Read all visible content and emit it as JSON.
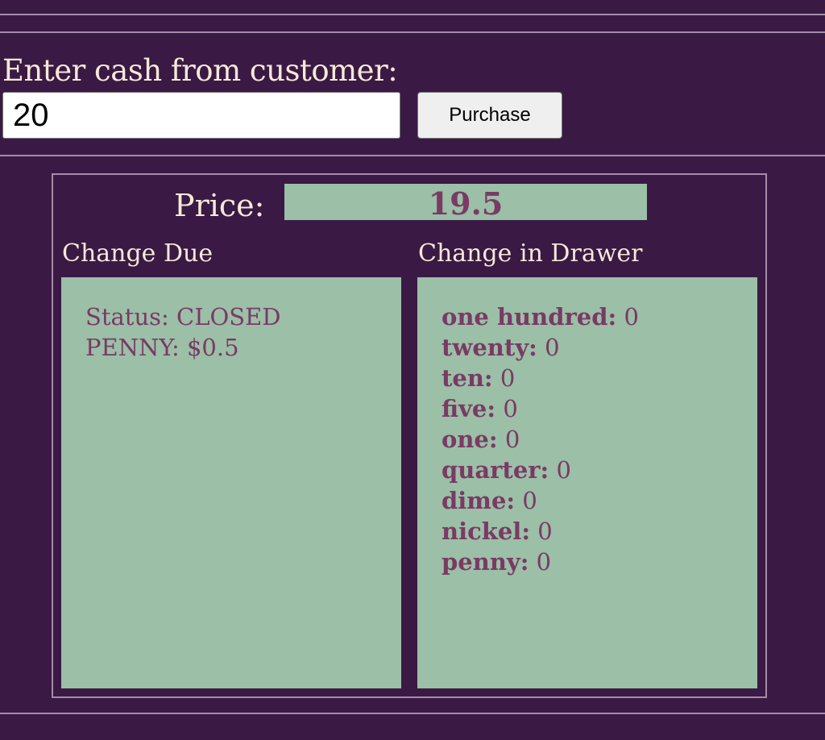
{
  "cash_input": {
    "label": "Enter cash from customer:",
    "value": "20"
  },
  "purchase_button": {
    "label": "Purchase"
  },
  "price": {
    "label": "Price:",
    "value": "19.5"
  },
  "change_due": {
    "title": "Change Due",
    "status": "Status: CLOSED",
    "lines": [
      "PENNY: $0.5"
    ]
  },
  "change_in_drawer": {
    "title": "Change in Drawer",
    "items": [
      {
        "label": "one hundred:",
        "value": "0"
      },
      {
        "label": "twenty:",
        "value": "0"
      },
      {
        "label": "ten:",
        "value": "0"
      },
      {
        "label": "five:",
        "value": "0"
      },
      {
        "label": "one:",
        "value": "0"
      },
      {
        "label": "quarter:",
        "value": "0"
      },
      {
        "label": "dime:",
        "value": "0"
      },
      {
        "label": "nickel:",
        "value": "0"
      },
      {
        "label": "penny:",
        "value": "0"
      }
    ]
  },
  "colors": {
    "background": "#3a1a44",
    "panel": "#9bbfa7",
    "accent_text": "#7a3a64",
    "light_text": "#f8e8d8",
    "rule": "#a58ba9"
  }
}
